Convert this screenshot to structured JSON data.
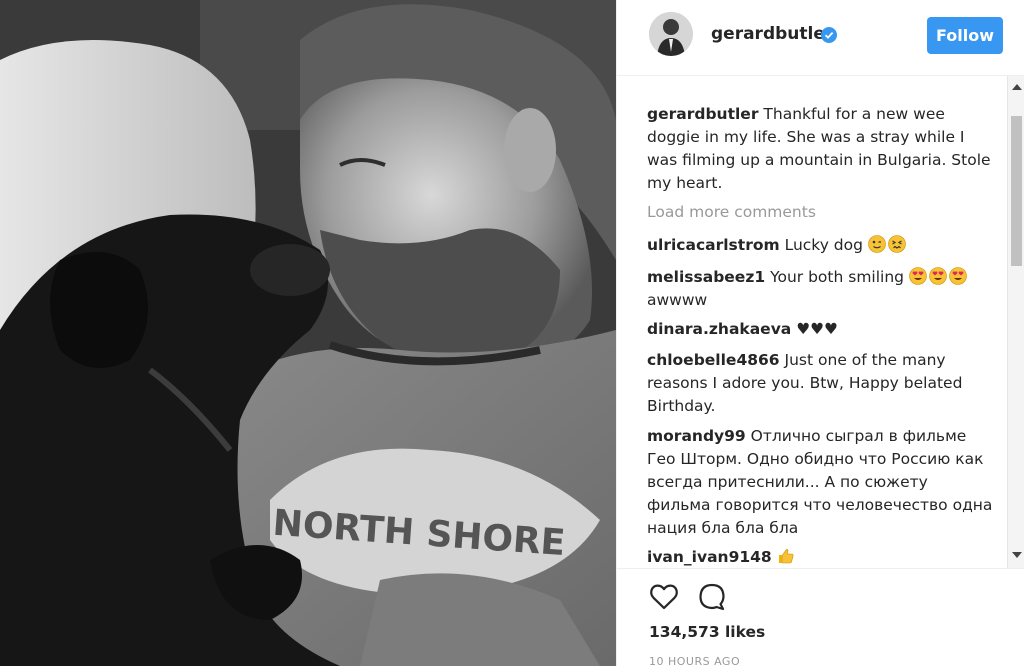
{
  "post": {
    "username": "gerardbutler",
    "follow_label": "Follow",
    "shirt_text": "NORTH SHORE",
    "verified_icon": "verified-badge-icon",
    "accent_color": "#3897f0"
  },
  "caption": {
    "username": "gerardbutler",
    "text": "Thankful for a new wee doggie in my life. She was a stray while I was filming up a mountain in Bulgaria. Stole my heart."
  },
  "load_more": "Load more comments",
  "comments": [
    {
      "user": "ulricacarlstrom",
      "text": "Lucky dog",
      "emojis": [
        "winking-face",
        "confounded-face"
      ]
    },
    {
      "user": "melissabeez1",
      "text": "Your both smiling",
      "emojis": [
        "heart-eyes",
        "heart-eyes",
        "heart-eyes"
      ],
      "text2": "awwww"
    },
    {
      "user": "dinara.zhakaeva",
      "text": "♥♥♥"
    },
    {
      "user": "chloebelle4866",
      "text": "Just one of the many reasons I adore you. Btw, Happy belated Birthday."
    },
    {
      "user": "morandy99",
      "text": "Отлично сыграл в фильме Гео Шторм. Одно обидно что Россию как всегда притеснили... А по сюжету фильма говорится что человечество одна нация бла бла бла"
    },
    {
      "user": "ivan_ivan9148",
      "text": "",
      "emojis": [
        "thumbs-up"
      ]
    }
  ],
  "likes": "134,573 likes",
  "time": "10 HOURS AGO",
  "icons": {
    "like": "heart-outline-icon",
    "comment": "speech-bubble-icon"
  }
}
